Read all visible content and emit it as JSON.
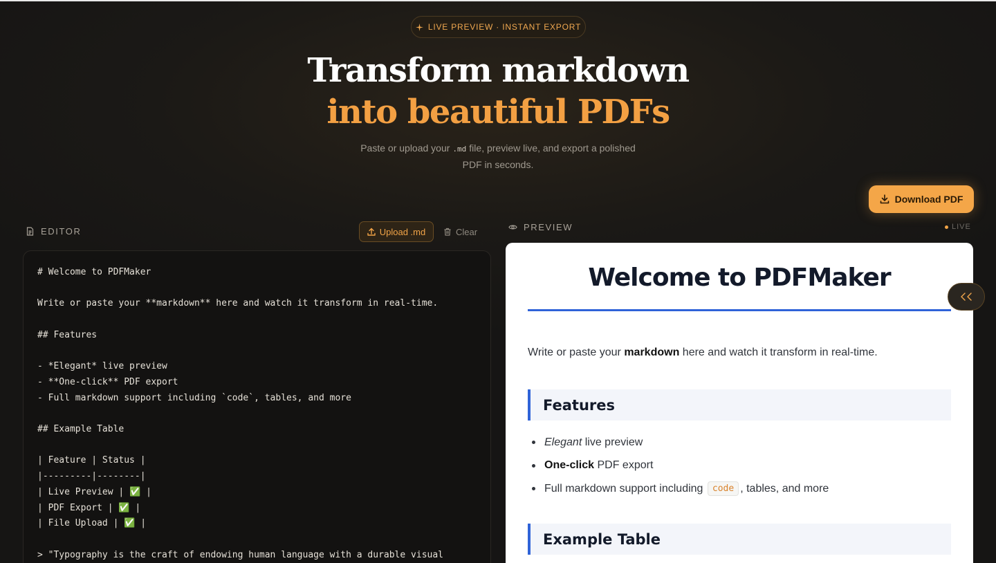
{
  "hero": {
    "badge": "Live Preview · Instant Export",
    "title_line1": "Transform markdown",
    "title_line2": "into beautiful PDFs",
    "subtitle_before": "Paste or upload your",
    "subtitle_code": ".md",
    "subtitle_after": "file, preview live, and export a polished PDF in seconds."
  },
  "toolbar": {
    "download_label": "Download PDF",
    "upload_label": "Upload .md",
    "clear_label": "Clear"
  },
  "editor": {
    "label": "EDITOR",
    "content": "# Welcome to PDFMaker\n\nWrite or paste your **markdown** here and watch it transform in real-time.\n\n## Features\n\n- *Elegant* live preview\n- **One-click** PDF export\n- Full markdown support including `code`, tables, and more\n\n## Example Table\n\n| Feature | Status |\n|---------|--------|\n| Live Preview | ✅ |\n| PDF Export | ✅ |\n| File Upload | ✅ |\n\n> \"Typography is the craft of endowing human language with a durable visual"
  },
  "preview": {
    "label": "PREVIEW",
    "live": "LIVE",
    "h1": "Welcome to PDFMaker",
    "para_before": "Write or paste your",
    "para_bold": "markdown",
    "para_after": "here and watch it transform in real-time.",
    "h2_features": "Features",
    "list": {
      "item1_em": "Elegant",
      "item1_rest": "live preview",
      "item2_bold": "One-click",
      "item2_rest": "PDF export",
      "item3_before": "Full markdown support including",
      "item3_code": "code",
      "item3_after": ", tables, and more"
    },
    "h2_example": "Example Table"
  },
  "colors": {
    "accent": "#f3a043",
    "link_blue": "#2f63d8",
    "background": "#161514"
  },
  "icons": {
    "badge": "sparkle-icon",
    "download": "download-icon",
    "upload": "upload-icon",
    "clear": "trash-icon",
    "editor": "file-icon",
    "preview": "eye-icon",
    "collapse": "chevrons-left-icon"
  }
}
